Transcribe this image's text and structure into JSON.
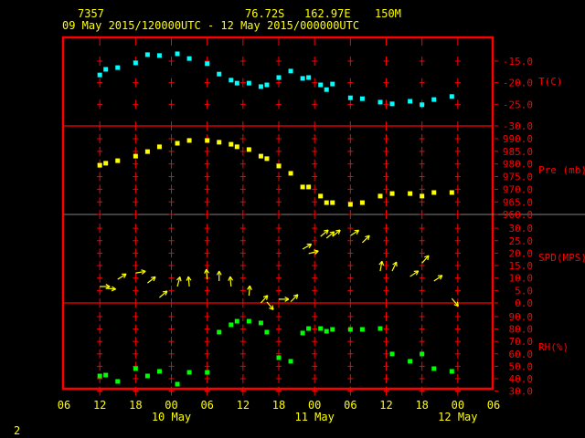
{
  "header": {
    "station": "7357",
    "lat": "76.72S",
    "lon": "162.97E",
    "elev": "150M",
    "period": "09 May 2015/120000UTC - 12 May 2015/000000UTC"
  },
  "footer": {
    "page": "2"
  },
  "colors": {
    "frame": "#ff0000",
    "temp": "#00ffff",
    "pres": "#ffff00",
    "wind": "#ffff00",
    "rh": "#00ff00",
    "text": "#ffff00",
    "sep": "#808080"
  },
  "chart_data": {
    "type": "scatter",
    "title": "7357  76.72S 162.97E 150M",
    "x_unit": "hours after 09 May 06UTC",
    "xlim": [
      0,
      72
    ],
    "x_ticks": [
      "06",
      "12",
      "18",
      "00",
      "06",
      "12",
      "18",
      "00",
      "06",
      "12",
      "18",
      "00",
      "06"
    ],
    "date_labels": [
      {
        "label": "10 May",
        "hour": 18
      },
      {
        "label": "11 May",
        "hour": 42
      },
      {
        "label": "12 May",
        "hour": 66
      }
    ],
    "panels": [
      {
        "name": "T(C)",
        "ylim": [
          -30,
          -12
        ],
        "ticks": [
          "-15.0",
          "-20.0",
          "-25.0",
          "-30.0"
        ],
        "tick_values": [
          -15,
          -20,
          -25,
          -30
        ],
        "x": [
          6,
          7,
          9,
          12,
          14,
          16,
          19,
          21,
          24,
          26,
          28,
          29,
          31,
          33,
          34,
          36,
          38,
          40,
          41,
          43,
          44,
          45,
          48,
          50,
          53,
          55,
          58,
          60,
          62,
          65
        ],
        "y": [
          -18.2,
          -16.9,
          -16.5,
          -15.4,
          -13.5,
          -13.7,
          -13.3,
          -14.4,
          -15.6,
          -18.0,
          -19.4,
          -20.1,
          -20.1,
          -20.9,
          -20.5,
          -18.8,
          -17.3,
          -19.0,
          -18.8,
          -20.5,
          -21.6,
          -20.3,
          -23.5,
          -23.7,
          -24.5,
          -24.9,
          -24.3,
          -25.1,
          -23.9,
          -23.2
        ]
      },
      {
        "name": "Pre (mb)",
        "ylim": [
          960,
          990
        ],
        "ticks": [
          "990.0",
          "985.0",
          "980.0",
          "975.0",
          "970.0",
          "965.0",
          "960.0"
        ],
        "tick_values": [
          990,
          985,
          980,
          975,
          970,
          965,
          960
        ],
        "x": [
          6,
          7,
          9,
          12,
          14,
          16,
          19,
          21,
          24,
          26,
          28,
          29,
          31,
          33,
          34,
          36,
          38,
          40,
          41,
          43,
          44,
          45,
          48,
          50,
          53,
          55,
          58,
          60,
          62,
          65
        ],
        "y": [
          979.5,
          980.3,
          981.3,
          983.1,
          984.9,
          986.8,
          988.2,
          989.3,
          989.3,
          988.6,
          987.8,
          986.8,
          985.7,
          983.1,
          982.1,
          979.2,
          976.3,
          970.9,
          970.9,
          967.3,
          964.7,
          964.7,
          964.0,
          964.7,
          967.3,
          968.3,
          968.3,
          967.3,
          968.7,
          968.7
        ]
      },
      {
        "name": "SPD(MPS)",
        "ylim": [
          0,
          30
        ],
        "ticks": [
          "30.0",
          "25.0",
          "20.0",
          "15.0",
          "10.0",
          "5.0",
          "0.0"
        ],
        "tick_values": [
          30,
          25,
          20,
          15,
          10,
          5,
          0
        ],
        "x": [
          6,
          7,
          9,
          12,
          14,
          16,
          19,
          21,
          24,
          26,
          28,
          31,
          33,
          34,
          36,
          38,
          40,
          41,
          43,
          44,
          45,
          48,
          50,
          53,
          55,
          58,
          60,
          62,
          65
        ],
        "y": [
          6.6,
          5.9,
          9.5,
          12,
          8,
          2.2,
          6.6,
          6.6,
          9.5,
          8.8,
          6.6,
          2.9,
          0,
          0.4,
          1.5,
          0.5,
          21.6,
          19.8,
          26.7,
          26,
          26.7,
          27,
          24.2,
          12.8,
          12.8,
          10.6,
          16,
          8.8,
          1.8
        ],
        "arrow_to_deg": [
          90,
          95,
          58,
          80,
          52,
          50,
          15,
          355,
          355,
          0,
          355,
          5,
          42,
          140,
          90,
          45,
          60,
          75,
          50,
          50,
          50,
          57,
          45,
          10,
          25,
          56,
          42,
          56,
          140
        ]
      },
      {
        "name": "RH(%)",
        "ylim": [
          30,
          90
        ],
        "ticks": [
          "90.0",
          "80.0",
          "70.0",
          "60.0",
          "50.0",
          "40.0",
          "30.0"
        ],
        "tick_values": [
          90,
          80,
          70,
          60,
          50,
          40,
          30
        ],
        "x": [
          6,
          7,
          9,
          12,
          14,
          16,
          19,
          21,
          24,
          26,
          28,
          29,
          31,
          33,
          34,
          36,
          38,
          40,
          41,
          43,
          44,
          45,
          48,
          50,
          53,
          55,
          58,
          60,
          62,
          65
        ],
        "y": [
          42.2,
          42.9,
          37.8,
          48.1,
          42.2,
          45.9,
          35.6,
          45.1,
          45.1,
          77.5,
          83.4,
          86.3,
          86.3,
          84.9,
          77.5,
          56.9,
          54.0,
          76.8,
          80.4,
          80.4,
          78.2,
          79.7,
          79.7,
          79.7,
          80.4,
          59.9,
          54.0,
          59.9,
          48.1,
          45.9
        ]
      }
    ]
  }
}
